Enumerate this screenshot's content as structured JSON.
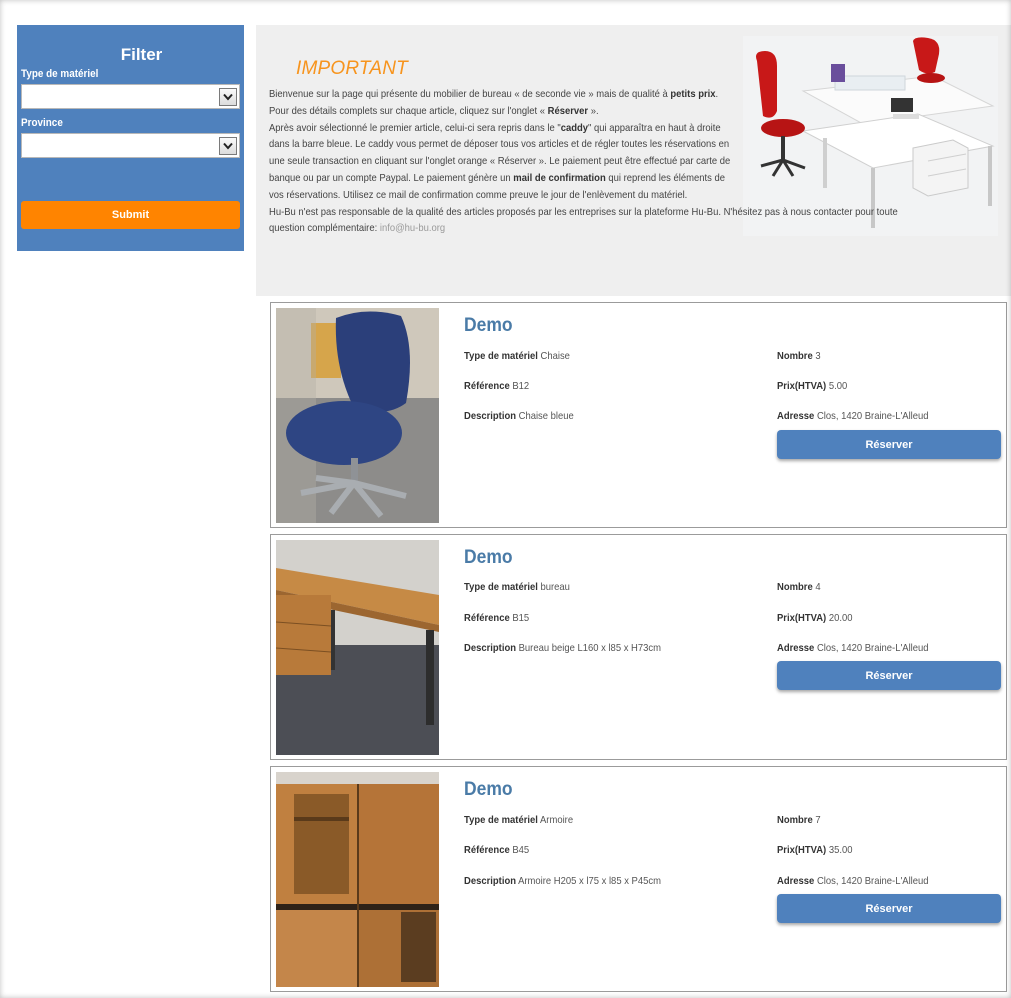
{
  "filter": {
    "title": "Filter",
    "type_label": "Type de matériel",
    "type_value": "",
    "province_label": "Province",
    "province_value": "",
    "submit_label": "Submit"
  },
  "info": {
    "title": "IMPORTANT",
    "p1_a": "Bienvenue sur la page qui présente du mobilier de bureau « de seconde vie » mais de qualité à ",
    "p1_b": "petits prix",
    "p1_c": ".",
    "p2_a": "Pour des détails complets sur chaque article, cliquez sur l'onglet « ",
    "p2_b": "Réserver",
    "p2_c": " ».",
    "p3_a": "Après avoir sélectionné le premier article, celui-ci sera repris dans le \"",
    "p3_b": "caddy",
    "p3_c": "\" qui apparaîtra en haut à droite dans la barre bleue. Le caddy vous permet de déposer tous vos articles et de régler toutes les réservations en une seule transaction en cliquant sur l'onglet orange « Réserver ». Le paiement peut être effectué par carte de banque ou par un compte Paypal. Le paiement génère un ",
    "p3_d": "mail de confirmation",
    "p3_e": " qui reprend les éléments de vos réservations. Utilisez ce mail de confirmation comme preuve le jour de l'enlèvement du matériel.",
    "p4": "Hu-Bu n'est pas responsable de la qualité des articles proposés par les entreprises sur la plateforme Hu-Bu. N'hésitez pas à nous contacter pour toute question complémentaire: ",
    "email": "info@hu-bu.org"
  },
  "labels": {
    "type": "Type de matériel",
    "reference": "Référence",
    "description": "Description",
    "nombre": "Nombre",
    "prix": "Prix(HTVA)",
    "adresse": "Adresse",
    "reserve": "Réserver"
  },
  "products": [
    {
      "title": "Demo",
      "type": "Chaise",
      "reference": "B12",
      "description": "Chaise bleue",
      "nombre": "3",
      "prix": "5.00",
      "adresse": "Clos, 1420 Braine-L'Alleud"
    },
    {
      "title": "Demo",
      "type": "bureau",
      "reference": "B15",
      "description": "Bureau beige L160 x l85 x H73cm",
      "nombre": "4",
      "prix": "20.00",
      "adresse": "Clos, 1420 Braine-L'Alleud"
    },
    {
      "title": "Demo",
      "type": "Armoire",
      "reference": "B45",
      "description": "Armoire H205 x l75 x l85 x P45cm",
      "nombre": "7",
      "prix": "35.00",
      "adresse": "Clos, 1420 Braine-L'Alleud"
    }
  ],
  "colors": {
    "accent_blue": "#4f81bd",
    "accent_orange": "#ff8400",
    "title_orange": "#f7941d",
    "title_blue": "#4a7ba7"
  }
}
